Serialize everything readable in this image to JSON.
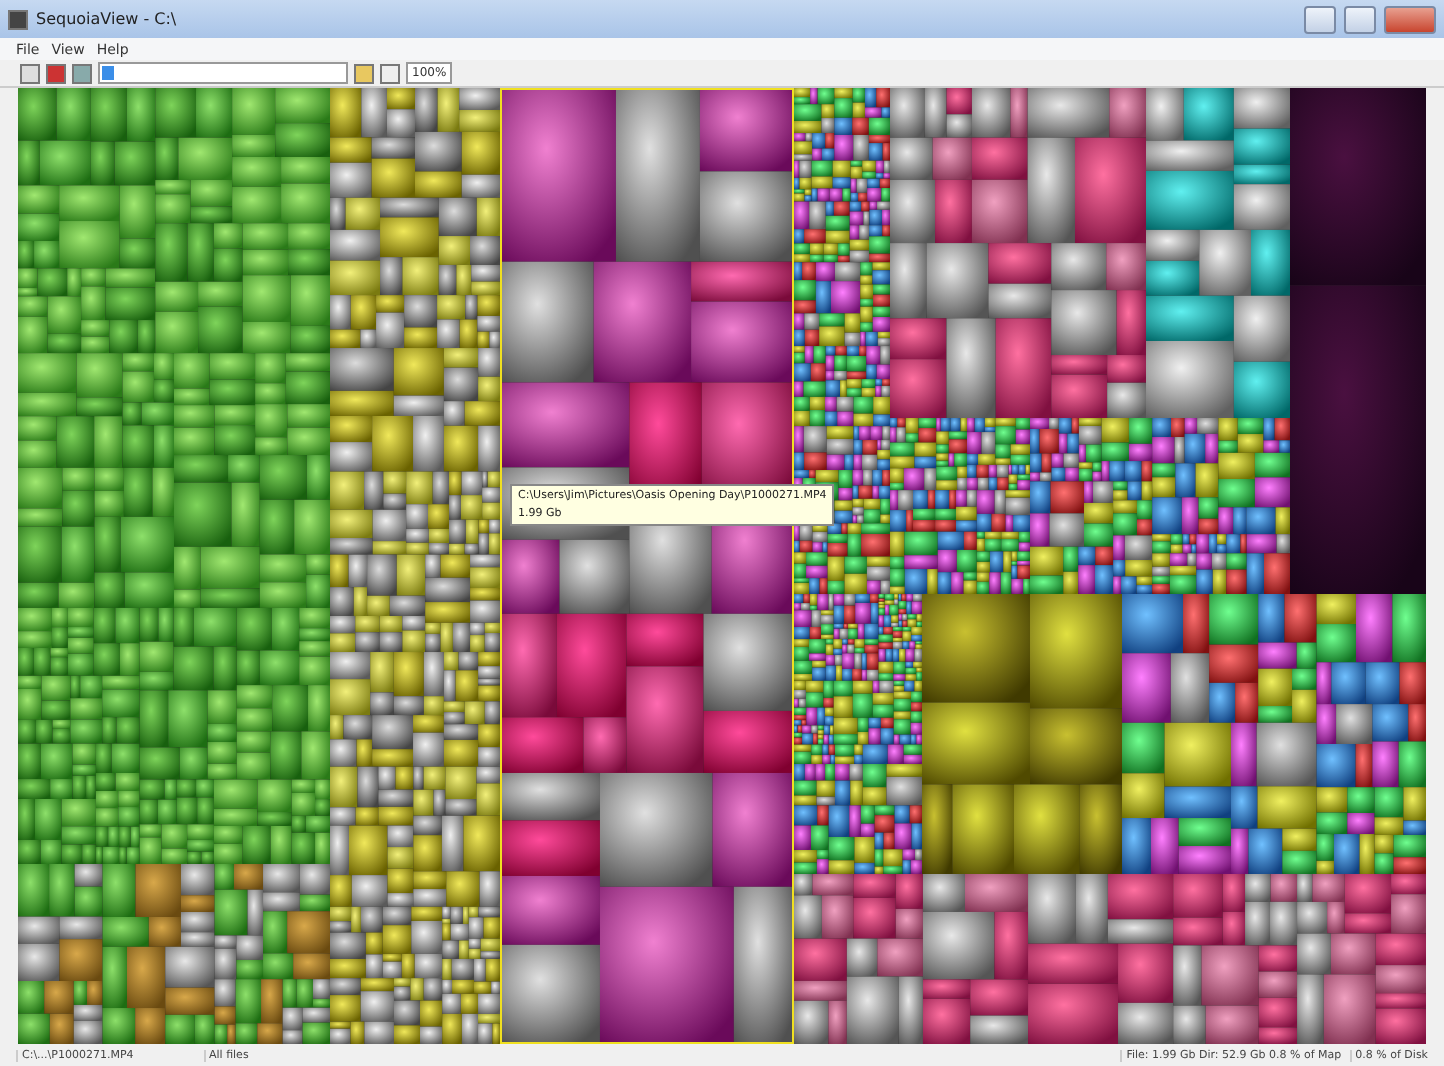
{
  "window": {
    "title": "SequoiaView - C:\\"
  },
  "menu": [
    "File",
    "View",
    "Help"
  ],
  "toolbar": {
    "zoom": "100%"
  },
  "tooltip": {
    "path": "C:\\Users\\Jim\\Pictures\\Oasis Opening Day\\P1000271.MP4",
    "size": "1.99 Gb"
  },
  "status_bar": [
    "C:\\...\\P1000271.MP4",
    "All files",
    "File: 1.99 Gb Dir: 52.9 Gb 0.8 % of Map",
    "0.8 % of Disk"
  ]
}
